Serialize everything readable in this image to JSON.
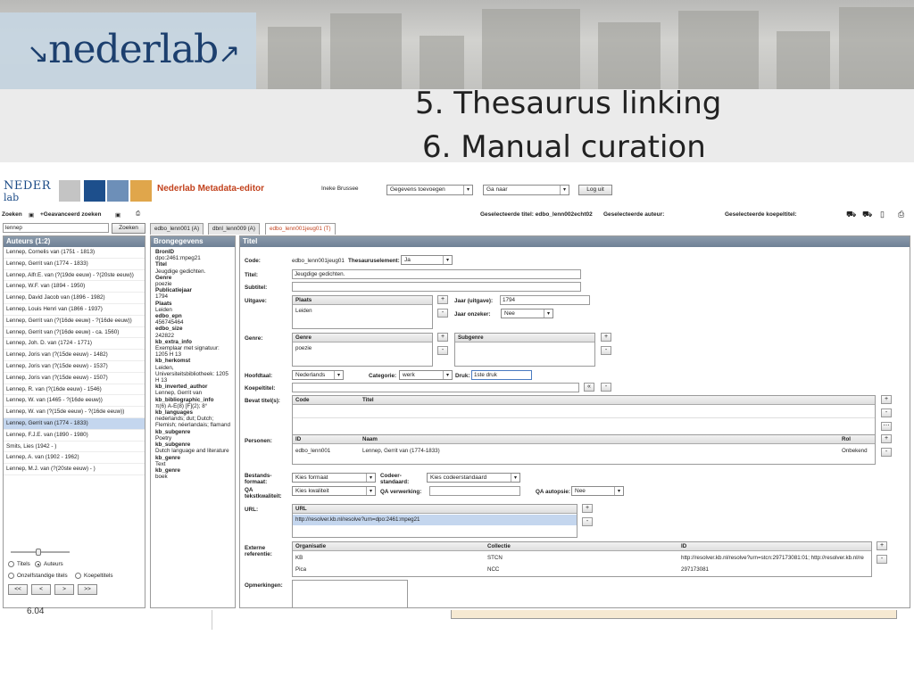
{
  "slide": {
    "logo": "nederlab",
    "title_line1": "5. Thesaurus linking",
    "title_line2": "6. Manual curation"
  },
  "app": {
    "logo_line1": "NEDER",
    "logo_line2": "lab",
    "title": "Nederlab Metadata-editor",
    "user": "Ineke Brussee",
    "add_select": "Gegevens toevoegen",
    "goto_select": "Ga naar",
    "logout": "Log uit",
    "search_label": "Zoeken",
    "advanced_search": "+Geavanceerd zoeken",
    "search_value": "lennep",
    "search_button": "Zoeken",
    "selected_title": "Geselecteerde titel: edbo_lenn002echt02",
    "selected_author": "Geselecteerde auteur:",
    "selected_koepel": "Geselecteerde koepeltitel:",
    "tabs": [
      "edbo_lenn001 (A)",
      "dbnl_lenn009 (A)",
      "edbo_lenn001jeug01 (T)"
    ],
    "authors_head": "Auteurs (1:2)",
    "authors": [
      "Lennep, Cornelis van (1751 - 1813)",
      "Lennep, Gerrit van (1774 - 1833)",
      "Lennep, Alfr.E. van (?(19de eeuw) - ?(20ste eeuw))",
      "Lennep, W.F. van (1894 - 1950)",
      "Lennep, David Jacob van (1896 - 1982)",
      "Lennep, Louis Henri van (1866 - 1937)",
      "Lennep, Gerrit van (?(16de eeuw) - ?(16de eeuw))",
      "Lennep, Gerrit van (?(16de eeuw) - ca. 1560)",
      "Lennep, Joh. D. van (1724 - 1771)",
      "Lennep, Joris van (?(15de eeuw) - 1482)",
      "Lennep, Joris van (?(15de eeuw) - 1537)",
      "Lennep, Joris van (?(15de eeuw) - 1507)",
      "Lennep, R. van (?(16de eeuw) - 1546)",
      "Lennep, W. van (1465 - ?(16de eeuw))",
      "Lennep, W. van (?(15de eeuw) - ?(16de eeuw))",
      "Lennep, Gerrit van (1774 - 1833)",
      "Lennep, F.J.E. van (1890 - 1980)",
      "Smits, Lies (1942 - )",
      "Lennep, A. van (1902 - 1962)",
      "Lennep, M.J. van (?(20ste eeuw) - )"
    ],
    "selected_author_index": 15,
    "radio_titels": "Titels",
    "radio_auteurs": "Auteurs",
    "radio_onzelf": "Onzelfstandige titels",
    "radio_koepel": "Koepeltitels",
    "nav_buttons": [
      "<<",
      "<",
      ">",
      ">>"
    ],
    "source_head": "Brongegevens",
    "source_lines": [
      {
        "t": "BronID",
        "b": true
      },
      {
        "t": "dpo:2461:mpeg21",
        "b": false
      },
      {
        "t": "Titel",
        "b": true
      },
      {
        "t": "Jeugdige gedichten.",
        "b": false
      },
      {
        "t": "Genre",
        "b": true
      },
      {
        "t": "poezie",
        "b": false
      },
      {
        "t": "Publicatiejaar",
        "b": true
      },
      {
        "t": "1794",
        "b": false
      },
      {
        "t": "Plaats",
        "b": true
      },
      {
        "t": "Leiden",
        "b": false
      },
      {
        "t": "edbo_epn",
        "b": true
      },
      {
        "t": "456745464",
        "b": false
      },
      {
        "t": "edbo_size",
        "b": true
      },
      {
        "t": "242822",
        "b": false
      },
      {
        "t": "kb_extra_info",
        "b": true
      },
      {
        "t": "Exemplaar met signatuur:",
        "b": false
      },
      {
        "t": "1205 H 13",
        "b": false
      },
      {
        "t": "kb_herkomst",
        "b": true
      },
      {
        "t": "Leiden,",
        "b": false
      },
      {
        "t": "Universiteitsbibliotheek: 1205",
        "b": false
      },
      {
        "t": "H 13",
        "b": false
      },
      {
        "t": "kb_inverted_author",
        "b": true
      },
      {
        "t": "Lennep, Gerrit van",
        "b": false
      },
      {
        "t": "kb_bibliographic_info",
        "b": true
      },
      {
        "t": "π(6) A-E(8) [F](2); 8°",
        "b": false
      },
      {
        "t": "kb_languages",
        "b": true
      },
      {
        "t": "nederlands; dut; Dutch;",
        "b": false
      },
      {
        "t": "Flemish; néerlandais; flamand",
        "b": false
      },
      {
        "t": "kb_subgenre",
        "b": true
      },
      {
        "t": "Poetry",
        "b": false
      },
      {
        "t": "kb_subgenre",
        "b": true
      },
      {
        "t": "Dutch language and literature",
        "b": false
      },
      {
        "t": "kb_genre",
        "b": true
      },
      {
        "t": "Text",
        "b": false
      },
      {
        "t": "kb_genre",
        "b": true
      },
      {
        "t": "boek",
        "b": false
      }
    ],
    "form_head": "Titel",
    "labels": {
      "code": "Code:",
      "titel": "Titel:",
      "subtitel": "Subtitel:",
      "uitgave": "Uitgave:",
      "genre": "Genre:",
      "hoofdtaal": "Hoofdtaal:",
      "koepeltitel": "Koepeltitel:",
      "bevat": "Bevat titel(s):",
      "personen": "Personen:",
      "bestands": "Bestands-",
      "formaat": "formaat:",
      "qa": "QA",
      "tekstkwal": "tekstkwaliteit:",
      "url": "URL:",
      "externe": "Externe",
      "referentie": "referentie:",
      "opmerkingen": "Opmerkingen:",
      "thesaurus": "Thesauruselement:",
      "jaar": "Jaar (uitgave):",
      "jaar_onzeker": "Jaar onzeker:",
      "categorie": "Categorie:",
      "druk": "Druk:",
      "codeer": "Codeer-",
      "standaard": "standaard:",
      "qa_verwerking": "QA verwerking:",
      "qa_autopsie": "QA autopsie:"
    },
    "values": {
      "code": "edbo_lenn001jeug01",
      "thesaurus": "Ja",
      "titel": "Jeugdige gedichten.",
      "jaar": "1794",
      "jaar_onzeker": "Nee",
      "plaats_head": "Plaats",
      "plaats": "Leiden",
      "genre_head": "Genre",
      "genre": "poezie",
      "subgenre_head": "Subgenre",
      "hoofdtaal": "Nederlands",
      "categorie": "werk",
      "druk": "1ste druk",
      "bevat_code": "Code",
      "bevat_titel": "Titel",
      "pers_id_h": "ID",
      "pers_naam_h": "Naam",
      "pers_rol_h": "Rol",
      "pers_id": "edbo_lenn001",
      "pers_naam": "Lennep, Gerrit van (1774-1833)",
      "pers_rol": "Onbekend",
      "bestandsformaat": "Kies formaat",
      "codeerstandaard": "Kies codeerstandaard",
      "qa_kwaliteit": "Kies kwaliteit",
      "qa_autopsie": "Nee",
      "url_head": "URL",
      "url": "http://resolver.kb.nl/resolve?urn=dpo:2461:mpeg21",
      "ext_org_h": "Organisatie",
      "ext_col_h": "Collectie",
      "ext_id_h": "ID",
      "ext_rows": [
        {
          "org": "KB",
          "col": "STCN",
          "id": "http://resolver.kb.nl/resolve?urn=stcn:297173081:01; http://resolver.kb.nl/re"
        },
        {
          "org": "Pica",
          "col": "NCC",
          "id": "297173081"
        }
      ]
    },
    "bottom_fragment": "6.04"
  }
}
